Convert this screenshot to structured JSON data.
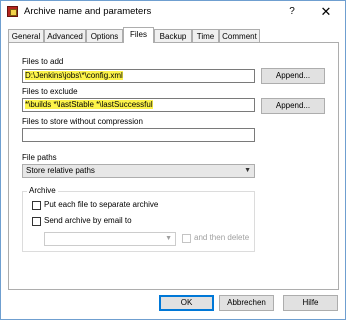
{
  "window": {
    "title": "Archive name and parameters",
    "help_glyph": "?",
    "close_glyph": "✕"
  },
  "tabs": [
    {
      "label": "General"
    },
    {
      "label": "Advanced"
    },
    {
      "label": "Options"
    },
    {
      "label": "Files",
      "active": true
    },
    {
      "label": "Backup"
    },
    {
      "label": "Time"
    },
    {
      "label": "Comment"
    }
  ],
  "files": {
    "files_to_add_label": "Files to add",
    "files_to_add_value": "D:\\Jenkins\\jobs\\*\\config.xml",
    "files_to_exclude_label": "Files to exclude",
    "files_to_exclude_value": "*\\builds *\\lastStable *\\lastSuccessful",
    "no_compression_label": "Files to store without compression",
    "no_compression_value": "",
    "append_label": "Append..."
  },
  "file_paths": {
    "label": "File paths",
    "selected": "Store relative paths"
  },
  "archive_group": {
    "legend": "Archive",
    "separate_label": "Put each file to separate archive",
    "separate_checked": false,
    "email_label": "Send archive by email to",
    "email_checked": false,
    "email_value": "",
    "delete_label": "and then delete",
    "delete_checked": false
  },
  "footer": {
    "ok": "OK",
    "cancel": "Abbrechen",
    "help": "Hilfe"
  },
  "colors": {
    "highlight": "#fcf34a",
    "accent": "#0078d7",
    "icon": "#b5251e"
  }
}
